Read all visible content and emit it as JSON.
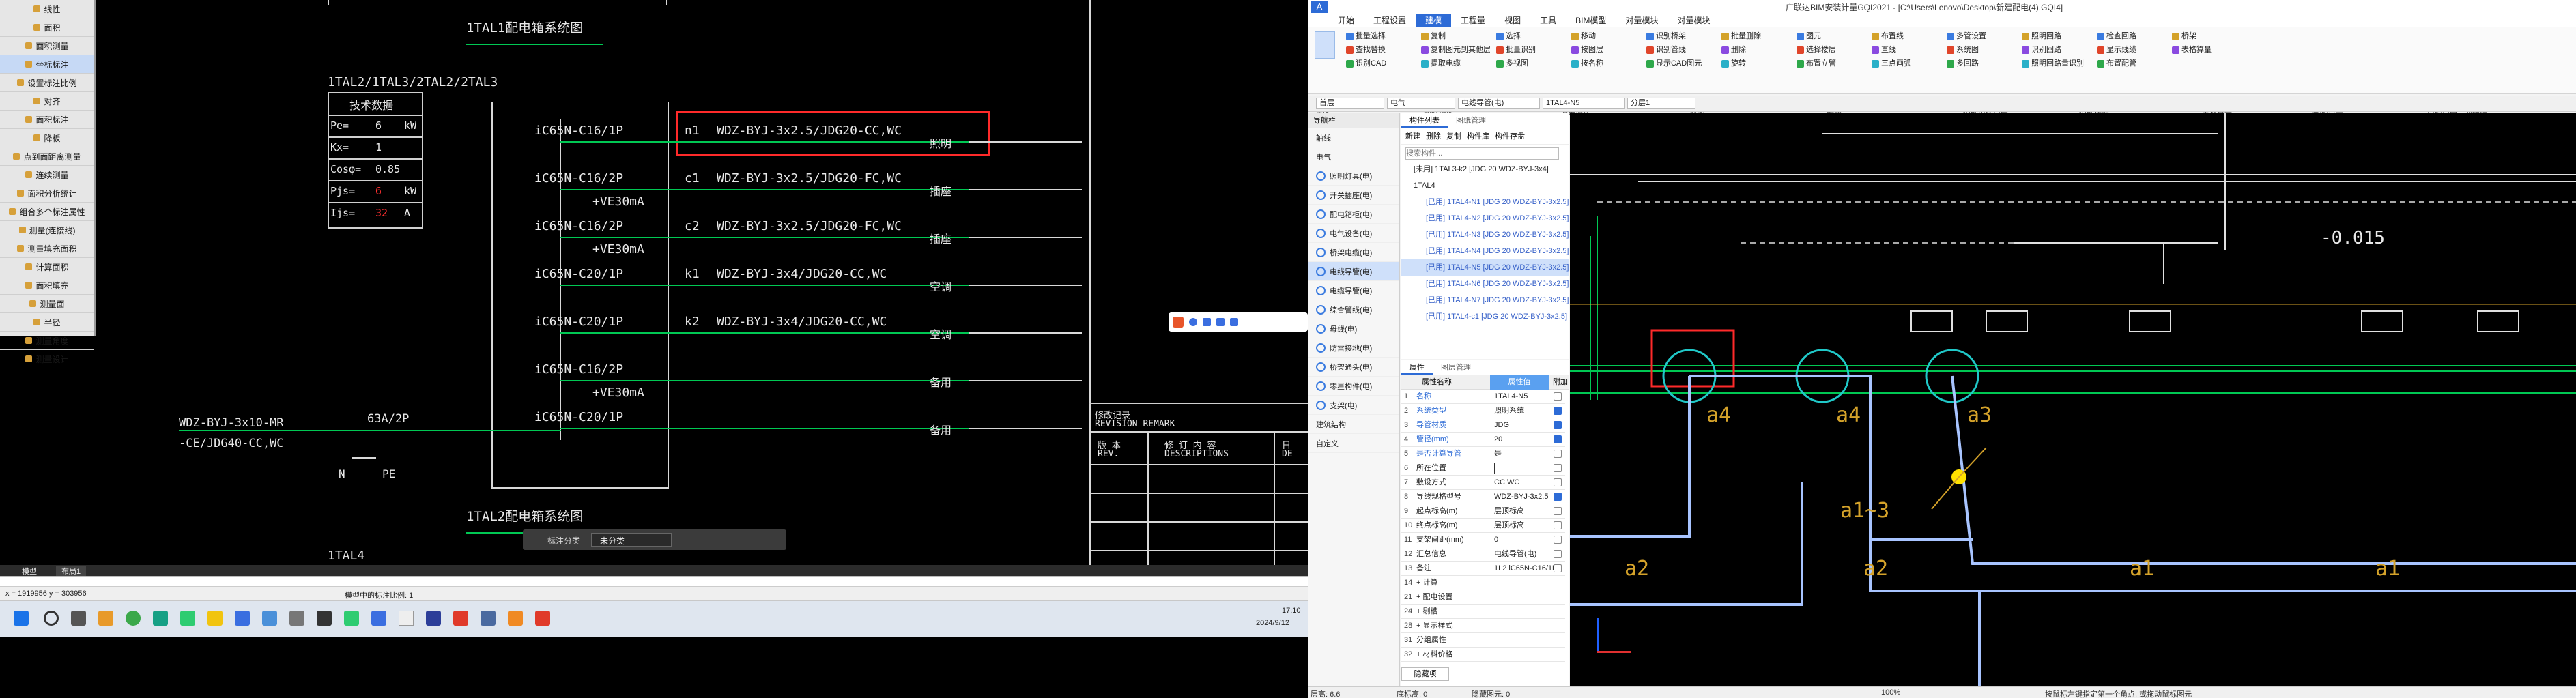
{
  "left_cad": {
    "title_top": "1TAL1配电箱系统图",
    "title_bottom": "1TAL2配电箱系统图",
    "box_labels": "1TAL2/1TAL3/2TAL2/2TAL3",
    "bottom_label": "1TAL4",
    "tech_table": {
      "title": "技术数据",
      "rows": [
        {
          "key": "Pe=",
          "value": "6",
          "unit": "kW"
        },
        {
          "key": "Kx=",
          "value": "1",
          "unit": ""
        },
        {
          "key": "Cosφ=",
          "value": "0.85",
          "unit": ""
        },
        {
          "key": "Pjs=",
          "value": "6",
          "unit": "kW"
        },
        {
          "key": "Ijs=",
          "value": "32",
          "unit": "A"
        }
      ]
    },
    "breakers": [
      {
        "label": "iC65N-C16/1P",
        "rcd": "",
        "circuit": "n1",
        "cable": "WDZ-BYJ-3x2.5/JDG20-CC,WC",
        "load": "照明"
      },
      {
        "label": "iC65N-C16/2P",
        "rcd": "+VE30mA",
        "circuit": "c1",
        "cable": "WDZ-BYJ-3x2.5/JDG20-FC,WC",
        "load": "插座"
      },
      {
        "label": "iC65N-C16/2P",
        "rcd": "+VE30mA",
        "circuit": "c2",
        "cable": "WDZ-BYJ-3x2.5/JDG20-FC,WC",
        "load": "插座"
      },
      {
        "label": "iC65N-C20/1P",
        "rcd": "",
        "circuit": "k1",
        "cable": "WDZ-BYJ-3x4/JDG20-CC,WC",
        "load": "空调"
      },
      {
        "label": "iC65N-C20/1P",
        "rcd": "",
        "circuit": "k2",
        "cable": "WDZ-BYJ-3x4/JDG20-CC,WC",
        "load": "空调"
      },
      {
        "label": "iC65N-C16/2P",
        "rcd": "+VE30mA",
        "circuit": "",
        "cable": "",
        "load": "备用"
      },
      {
        "label": "iC65N-C20/1P",
        "rcd": "",
        "circuit": "",
        "cable": "",
        "load": "备用"
      }
    ],
    "incoming_line1": "WDZ-BYJ-3x10-MR",
    "incoming_line2": "-CE/JDG40-CC,WC",
    "main_breaker": "63A/2P",
    "n_label": "N",
    "pe_label": "PE",
    "revision": {
      "title_cn": "修改记录",
      "title_en": "REVISION REMARK",
      "col1_cn": "版 本",
      "col1_en": "REV.",
      "col2_cn": "修 订 内 容",
      "col2_en": "DESCRIPTIONS",
      "col3_cn": "日",
      "col3_en": "DE"
    },
    "float_toolbar": {
      "label": "标注分类",
      "value": "未分类"
    },
    "tabs": [
      "模型",
      "布局1"
    ],
    "coord": "x = 1919956  y = 303956",
    "scale_text": "模型中的标注比例: 1",
    "time": "17:10",
    "date": "2024/9/12"
  },
  "left_menu": [
    "线性",
    "面积",
    "面积测量",
    "坐标标注",
    "设置标注比例",
    "对齐",
    "面积标注",
    "降板",
    "点到面距离测量",
    "连续测量",
    "面积分析统计",
    "组合多个标注属性",
    "测量(连接线)",
    "测量填充面积",
    "计算面积",
    "面积填充",
    "测量面",
    "半径",
    "测量角度",
    "测量设计"
  ],
  "left_menu_selected": 3,
  "app": {
    "title": "广联达BIM安装计量GQI2021 - [C:\\Users\\Lenovo\\Desktop\\新建配电(4).GQI4]",
    "tabs": [
      "开始",
      "工程设置",
      "建模",
      "工程量",
      "视图",
      "工具",
      "BIM模型",
      "对量模块",
      "对量模块"
    ],
    "active_tab": 2,
    "ribbon_buttons": [
      "批量选择",
      "查找替换",
      "识别CAD",
      "复制",
      "复制图元到其他层",
      "提取电缆",
      "选择",
      "批量识别",
      "多视图",
      "移动",
      "按图层",
      "按名称",
      "识别桥架",
      "识别管线",
      "显示CAD图元",
      "批量删除",
      "删除",
      "旋转",
      "图元",
      "选择楼层",
      "布置立管",
      "布置线",
      "直线",
      "三点画弧",
      "多管设置",
      "系统图",
      "多回路",
      "照明回路",
      "识别回路",
      "照明回路量识别",
      "检查回路",
      "显示线缆",
      "布置配管",
      "桥架",
      "表格算量"
    ],
    "ribbon_groups": [
      "选择",
      "图纸操作",
      "通用操作",
      "修改",
      "绘图",
      "识别电线导管",
      "识别桥架",
      "表格算量",
      "检查/显示",
      "电缆导管二次编辑"
    ],
    "selector": {
      "floor": "首层",
      "major": "电气",
      "type": "电线导管(电)",
      "name": "1TAL4-N5",
      "layer": "分层1"
    },
    "nav_header": "导航栏",
    "nav_items": [
      "轴线",
      "电气",
      "照明灯具(电)",
      "开关插座(电)",
      "配电箱柜(电)",
      "电气设备(电)",
      "桥架电缆(电)",
      "电线导管(电)",
      "电缆导管(电)",
      "综合管线(电)",
      "母线(电)",
      "防雷接地(电)",
      "桥架通头(电)",
      "零星构件(电)",
      "支架(电)",
      "建筑结构",
      "自定义"
    ],
    "nav_selected": 7,
    "comp_tabs": [
      "构件列表",
      "图纸管理"
    ],
    "comp_tools": [
      "新建",
      "删除",
      "复制",
      "构件库",
      "构件存盘"
    ],
    "comp_search_placeholder": "搜索构件...",
    "comp_items": [
      "[未用] 1TAL3-k2 [JDG 20 WDZ-BYJ-3x4]",
      "1TAL4",
      "[已用] 1TAL4-N1 [JDG 20 WDZ-BYJ-3x2.5]",
      "[已用] 1TAL4-N2 [JDG 20 WDZ-BYJ-3x2.5]",
      "[已用] 1TAL4-N3 [JDG 20 WDZ-BYJ-3x2.5]",
      "[已用] 1TAL4-N4 [JDG 20 WDZ-BYJ-3x2.5]",
      "[已用] 1TAL4-N5 [JDG 20 WDZ-BYJ-3x2.5]",
      "[已用] 1TAL4-N6 [JDG 20 WDZ-BYJ-3x2.5]",
      "[已用] 1TAL4-N7 [JDG 20 WDZ-BYJ-3x2.5]",
      "[已用] 1TAL4-c1 [JDG 20 WDZ-BYJ-3x2.5]"
    ],
    "comp_selected": 6,
    "props_tabs": [
      "属性",
      "图层管理"
    ],
    "props_header": {
      "name": "属性名称",
      "value": "属性值",
      "extra": "附加"
    },
    "props": [
      {
        "n": "1",
        "k": "名称",
        "v": "1TAL4-N5",
        "cb": false
      },
      {
        "n": "2",
        "k": "系统类型",
        "v": "照明系统",
        "cb": true
      },
      {
        "n": "3",
        "k": "导管材质",
        "v": "JDG",
        "cb": true
      },
      {
        "n": "4",
        "k": "管径(mm)",
        "v": "20",
        "cb": true
      },
      {
        "n": "5",
        "k": "是否计算导管",
        "v": "是",
        "cb": false
      },
      {
        "n": "6",
        "k": "所在位置",
        "v": "",
        "cb": false
      },
      {
        "n": "7",
        "k": "敷设方式",
        "v": "CC WC",
        "cb": false
      },
      {
        "n": "8",
        "k": "导线规格型号",
        "v": "WDZ-BYJ-3x2.5",
        "cb": true
      },
      {
        "n": "9",
        "k": "起点标高(m)",
        "v": "层顶标高",
        "cb": false
      },
      {
        "n": "10",
        "k": "终点标高(m)",
        "v": "层顶标高",
        "cb": false
      },
      {
        "n": "11",
        "k": "支架间距(mm)",
        "v": "0",
        "cb": false
      },
      {
        "n": "12",
        "k": "汇总信息",
        "v": "电线导管(电)",
        "cb": false
      },
      {
        "n": "13",
        "k": "备注",
        "v": "1L2 iC65N-C16/1P",
        "cb": false
      },
      {
        "n": "14",
        "k": "+ 计算",
        "v": "",
        "cb": false
      },
      {
        "n": "21",
        "k": "+ 配电设置",
        "v": "",
        "cb": false
      },
      {
        "n": "24",
        "k": "+ 剔槽",
        "v": "",
        "cb": false
      },
      {
        "n": "28",
        "k": "+ 显示样式",
        "v": "",
        "cb": false
      },
      {
        "n": "31",
        "k": "分组属性",
        "v": "",
        "cb": false
      },
      {
        "n": "32",
        "k": "+ 材料价格",
        "v": "",
        "cb": false
      }
    ],
    "props_footer": "隐藏项",
    "rcad": {
      "elevation": "-0.015",
      "labels": [
        "a4",
        "a4",
        "a3",
        "a1~3",
        "a2",
        "a2",
        "a1",
        "a1"
      ],
      "status_bar": [
        "层高: 6.6",
        "底标高: 0",
        "隐藏图元: 0",
        "按鼠标左键指定第一个角点, 或拖动鼠标图元"
      ],
      "zoom": "100%"
    }
  },
  "colors": {
    "accent": "#2d6bd6",
    "cad_green": "#00c853",
    "cad_red": "#ff2a2a",
    "cad_cyan": "#20c8c8",
    "cad_orange": "#d4a22a"
  }
}
